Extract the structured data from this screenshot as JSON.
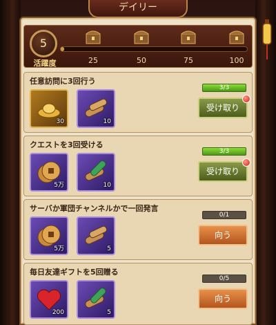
{
  "title": "デイリー",
  "activity": {
    "level": "5",
    "label": "活躍度",
    "progress_fraction": 0.02,
    "milestones": [
      "25",
      "50",
      "75",
      "100"
    ]
  },
  "quests": [
    {
      "title": "任意訪問に3回行う",
      "items": [
        {
          "icon": "gold-ingot-icon",
          "qty": "30",
          "frame": "gold"
        },
        {
          "icon": "scroll-bundle-icon",
          "qty": "10",
          "frame": "purple"
        }
      ],
      "progress": "3/3",
      "complete": true,
      "button": "受け取り"
    },
    {
      "title": "クエストを3回受ける",
      "items": [
        {
          "icon": "copper-coin-icon",
          "qty": "5万",
          "frame": "purple"
        },
        {
          "icon": "scroll-bundle-icon",
          "qty": "10",
          "frame": "purple"
        }
      ],
      "progress": "3/3",
      "complete": true,
      "button": "受け取り"
    },
    {
      "title": "サーバか軍団チャンネルかで一回発言",
      "items": [
        {
          "icon": "copper-coin-icon",
          "qty": "5万",
          "frame": "purple"
        },
        {
          "icon": "scroll-bundle-icon",
          "qty": "5",
          "frame": "purple"
        }
      ],
      "progress": "0/1",
      "complete": false,
      "button": "向う"
    },
    {
      "title": "毎日友達ギフトを5回贈る",
      "items": [
        {
          "icon": "heart-icon",
          "qty": "200",
          "frame": "purple"
        },
        {
          "icon": "scroll-bundle-icon",
          "qty": "5",
          "frame": "purple"
        }
      ],
      "progress": "0/5",
      "complete": false,
      "button": "向う"
    }
  ]
}
